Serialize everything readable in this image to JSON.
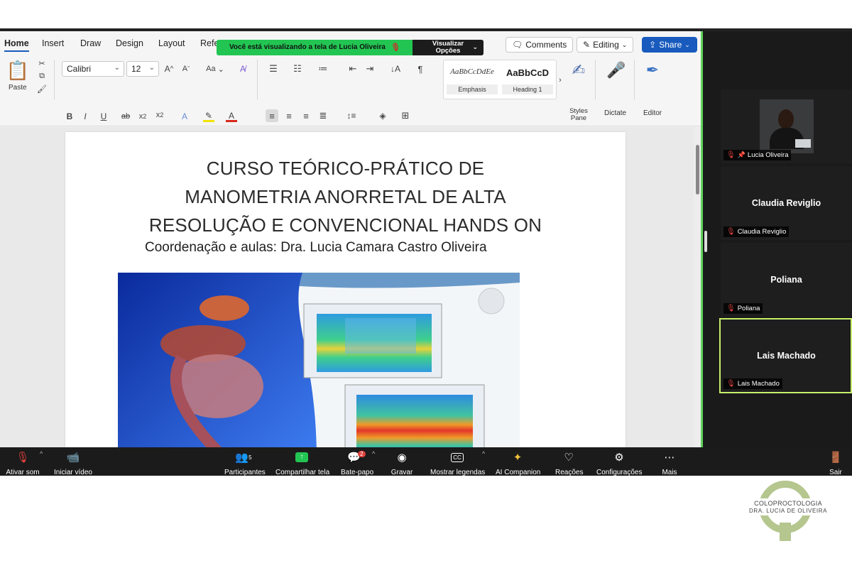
{
  "word": {
    "tabs": [
      "Home",
      "Insert",
      "Draw",
      "Design",
      "Layout",
      "Refe"
    ],
    "active_tab": "Home",
    "clipboard": {
      "paste_label": "Paste"
    },
    "font": {
      "name": "Calibri",
      "size": "12",
      "case_label": "Aa"
    },
    "styles": [
      {
        "sample": "AaBbCcDdEe",
        "name": "Emphasis"
      },
      {
        "sample": "AaBbCcD",
        "name": "Heading 1"
      }
    ],
    "styles_pane_label": "Styles\nPane",
    "dictate_label": "Dictate",
    "editor_label": "Editor",
    "comments_label": "Comments",
    "editing_label": "Editing",
    "share_label": "Share",
    "document": {
      "title_lines": [
        "CURSO TEÓRICO-PRÁTICO DE",
        "MANOMETRIA ANORRETAL DE ALTA",
        "RESOLUÇÃO E CONVENCIONAL HANDS ON"
      ],
      "subtitle": "Coordenação e aulas: Dra. Lucia Camara Castro Oliveira"
    }
  },
  "share_banner": {
    "text": "Você está visualizando a tela de  Lucia Oliveira",
    "options_line1": "Visualizar",
    "options_line2": "Opções"
  },
  "participants": [
    {
      "name": "Lucia Oliveira",
      "has_video": true,
      "pinned": true
    },
    {
      "name": "Claudia Reviglio",
      "has_video": false
    },
    {
      "name": "Poliana",
      "has_video": false
    },
    {
      "name": "Lais Machado",
      "has_video": false,
      "active_speaker": true
    }
  ],
  "toolbar": {
    "items": [
      {
        "label": "Ativar som",
        "icon": "mic-muted-icon"
      },
      {
        "label": "Iniciar vídeo",
        "icon": "video-off-icon"
      },
      {
        "label": "Participantes",
        "icon": "participants-icon",
        "count": "5"
      },
      {
        "label": "Compartilhar tela",
        "icon": "share-screen-icon"
      },
      {
        "label": "Bate-papo",
        "icon": "chat-icon",
        "badge": "2"
      },
      {
        "label": "Gravar",
        "icon": "record-icon"
      },
      {
        "label": "Mostrar legendas",
        "icon": "cc-icon"
      },
      {
        "label": "AI Companion",
        "icon": "sparkle-icon"
      },
      {
        "label": "Reações",
        "icon": "heart-icon"
      },
      {
        "label": "Configurações",
        "icon": "gear-icon"
      },
      {
        "label": "Mais",
        "icon": "more-icon"
      },
      {
        "label": "Sair",
        "icon": "leave-icon"
      }
    ]
  },
  "logo": {
    "line1": "COLOPROCTOLOGIA",
    "line2": "DRA. LUCIA DE OLIVEIRA",
    "color": "#b5c68f"
  },
  "colors": {
    "share_border": "#5fd35b",
    "banner_green": "#23c552",
    "share_blue": "#185abd"
  }
}
